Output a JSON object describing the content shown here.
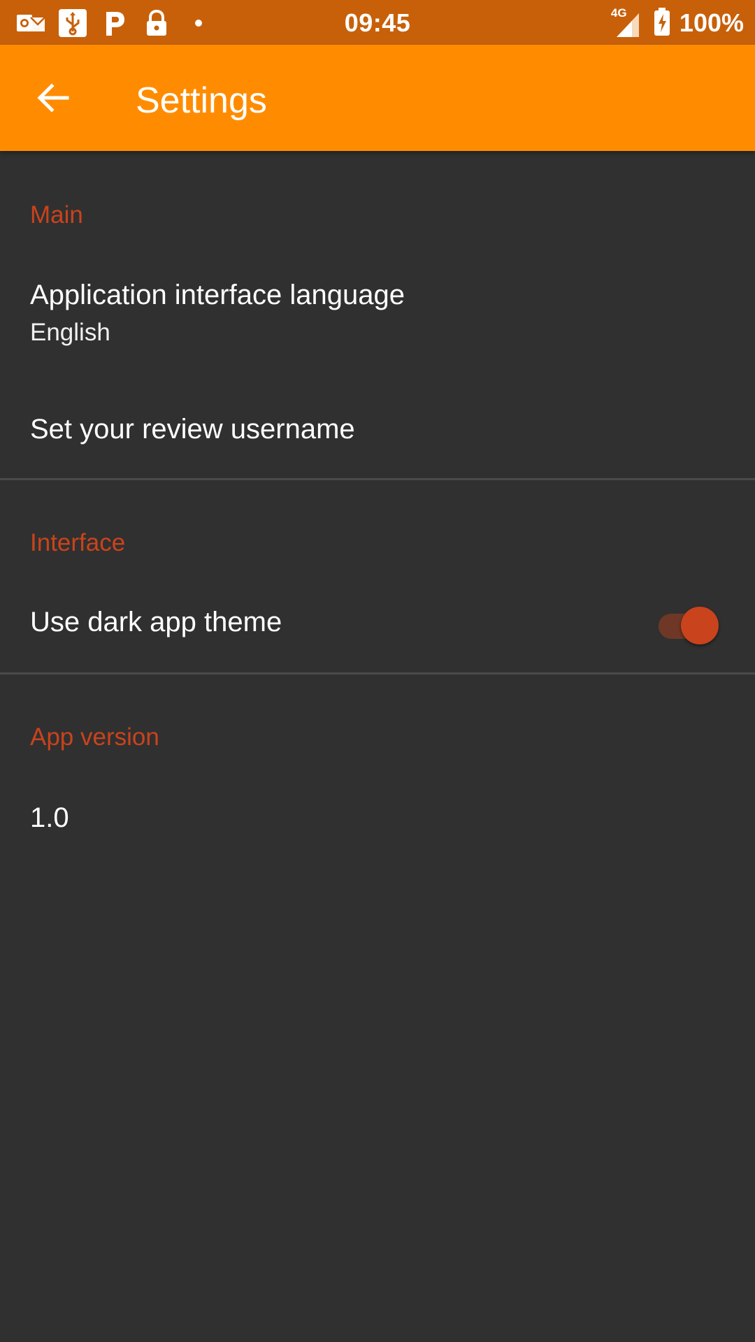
{
  "status_bar": {
    "time": "09:45",
    "network": "4G",
    "battery": "100%",
    "icons_left": [
      "outlook-icon",
      "usb-icon",
      "parking-icon",
      "lock-icon",
      "dot-icon"
    ],
    "background": "#c8600a"
  },
  "app_bar": {
    "title": "Settings",
    "background": "#ff8c00"
  },
  "sections": {
    "main": {
      "header": "Main",
      "language_title": "Application interface language",
      "language_value": "English",
      "username_title": "Set your review username"
    },
    "interface": {
      "header": "Interface",
      "dark_theme_title": "Use dark app theme",
      "dark_theme_enabled": true
    },
    "app_version": {
      "header": "App version",
      "value": "1.0"
    }
  },
  "colors": {
    "accent": "#c9431c",
    "background": "#303030",
    "text": "#ffffff"
  }
}
